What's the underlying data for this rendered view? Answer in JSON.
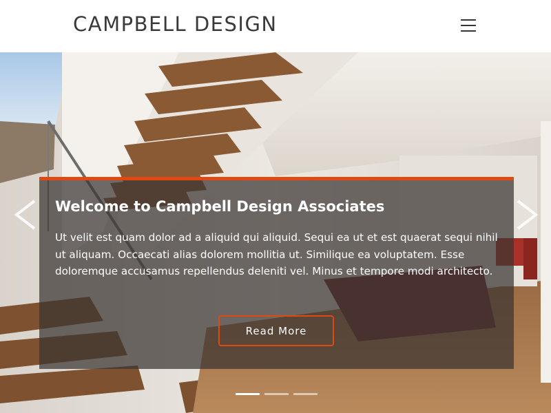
{
  "header": {
    "brand": "CAMPBELL DESIGN",
    "menu_icon": "hamburger-menu-icon"
  },
  "carousel": {
    "prev_icon": "chevron-left-icon",
    "next_icon": "chevron-right-icon",
    "slide": {
      "title": "Welcome to Campbell Design Associates",
      "text": "Ut velit est quam dolor ad a aliquid qui aliquid. Sequi ea ut et est quaerat sequi nihil ut aliquam. Occaecati alias dolorem mollitia ut. Similique ea voluptatem. Esse doloremque accusamus repellendus deleniti vel. Minus et tempore modi architecto.",
      "button_label": "Read More"
    },
    "slide_count": 3,
    "active_slide": 1
  },
  "colors": {
    "accent": "#e04a12",
    "caption_bg": "#3a3432",
    "header_bg": "#ffffff",
    "brand_text": "#3a3a3a"
  }
}
